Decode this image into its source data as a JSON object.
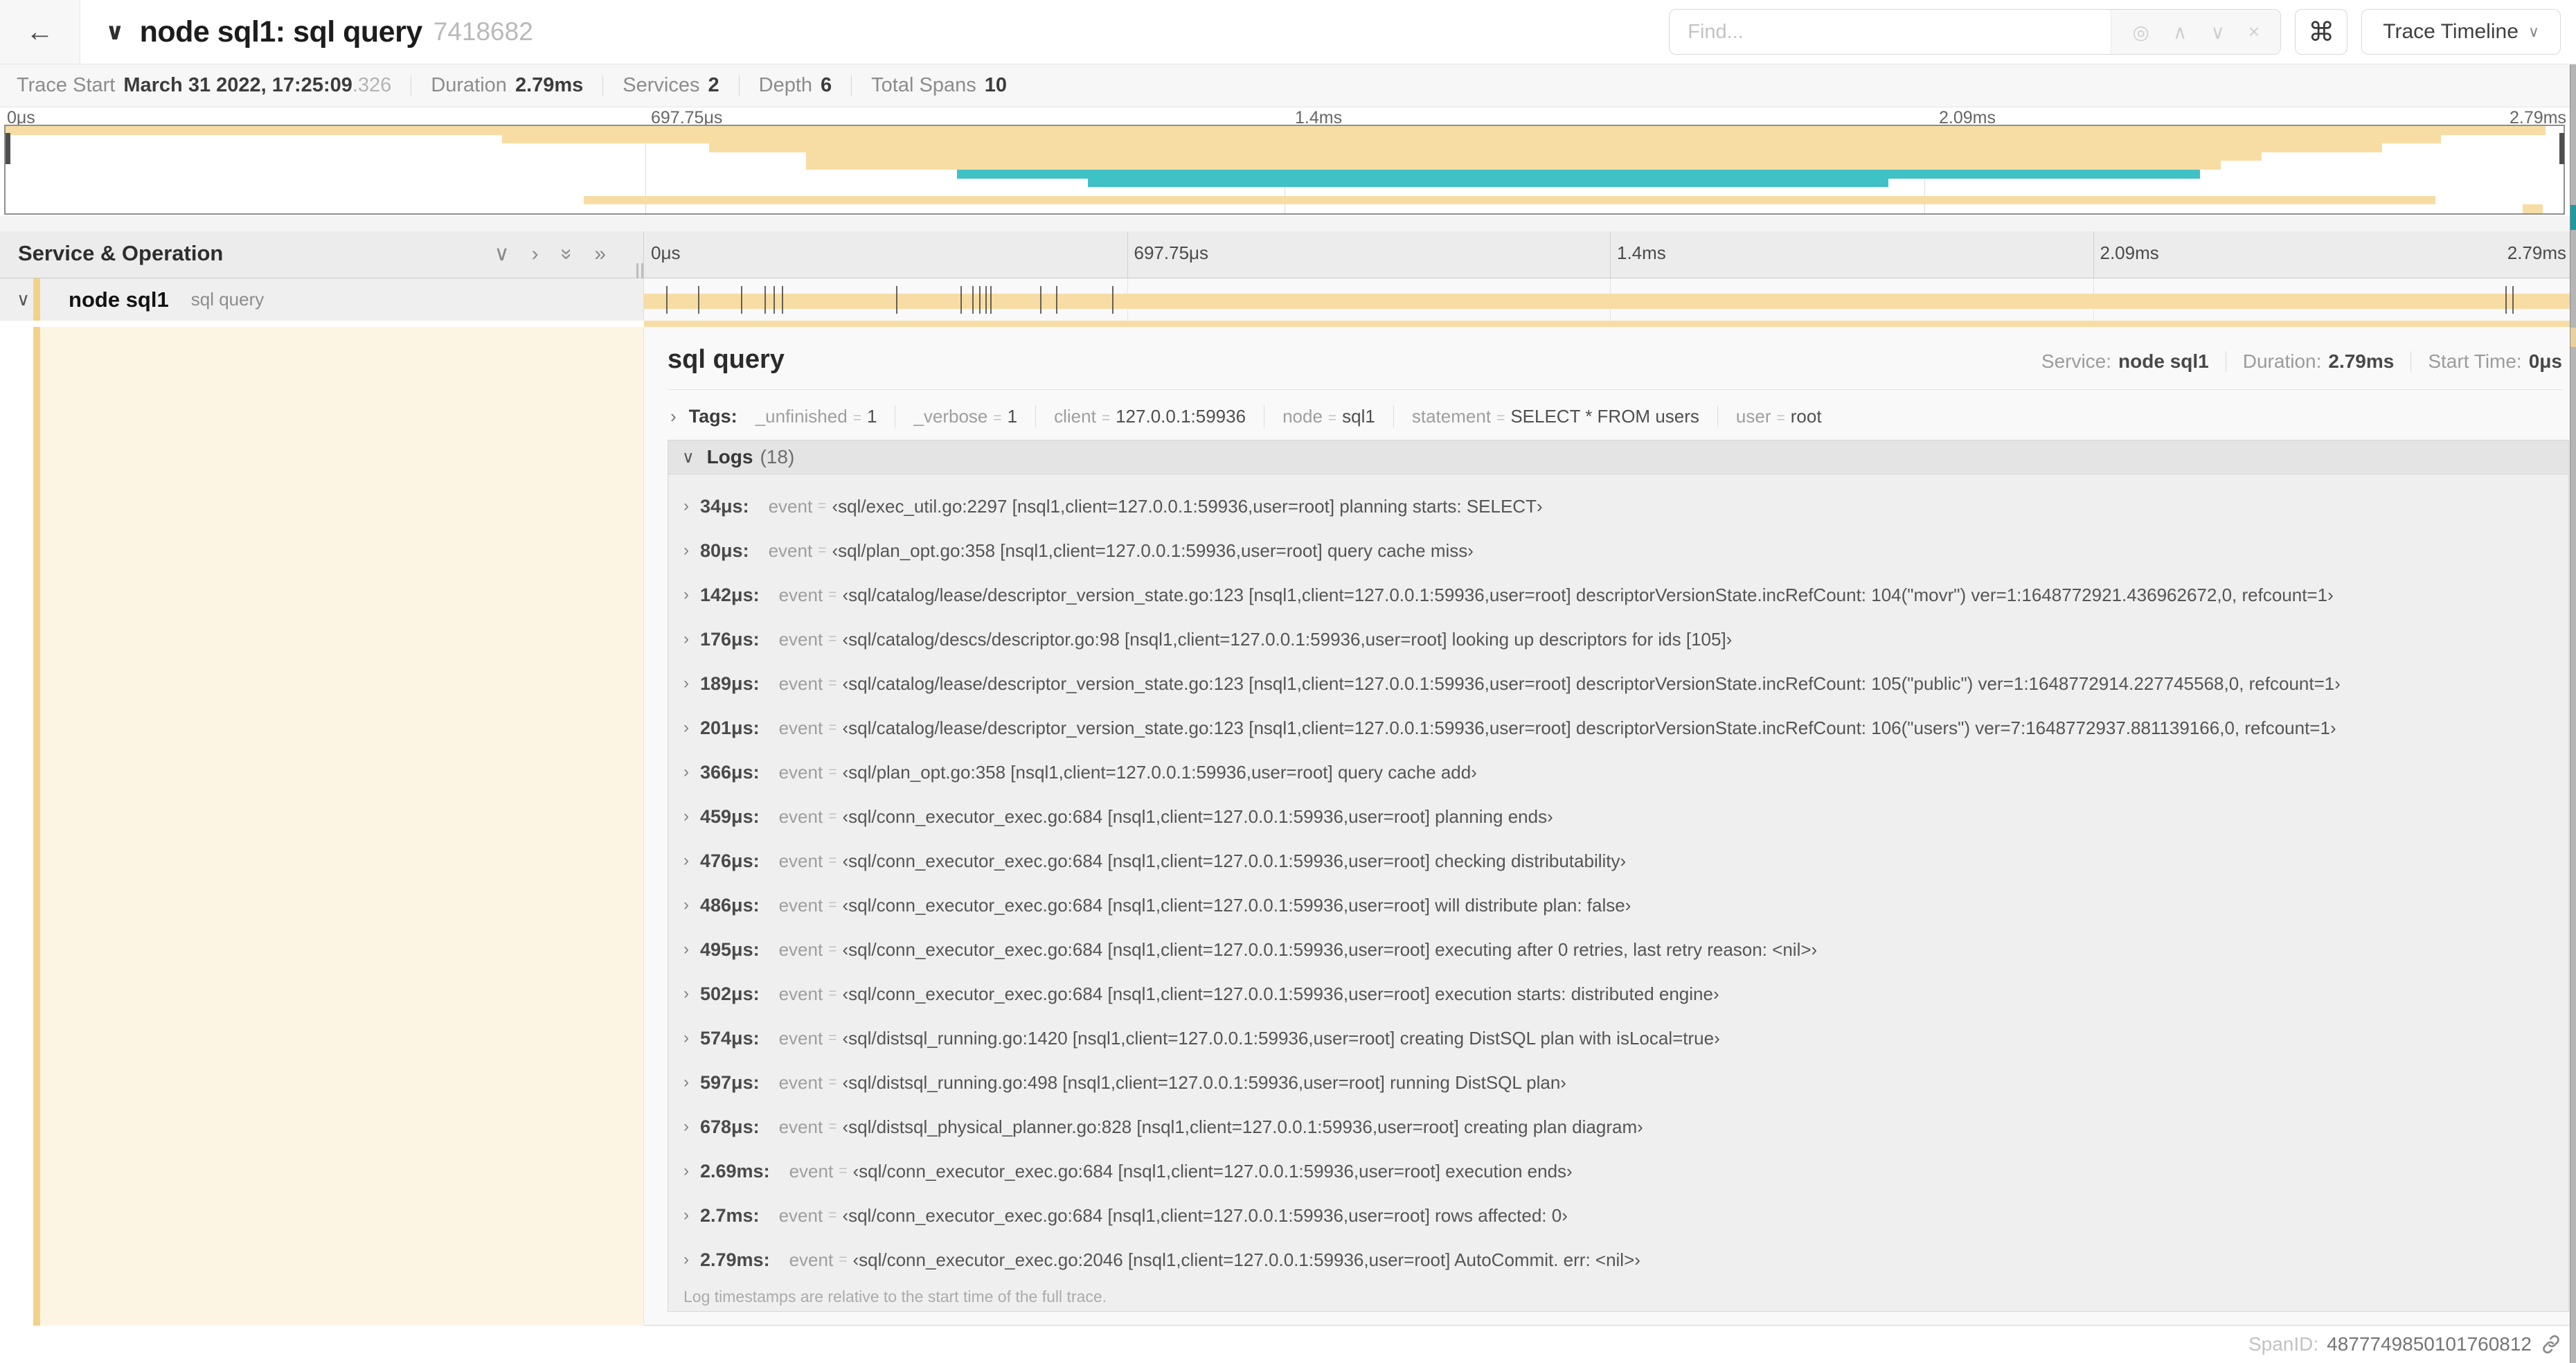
{
  "colors": {
    "span_cream": "#F7DDA4",
    "span_cream_strip": "#F2D28B",
    "span_cream_tint": "#FCF5E4",
    "span_teal": "#3FC1C6",
    "scrubber_gray": "#4E4E4E"
  },
  "topbar": {
    "back_icon": "←",
    "collapse_icon": "∨",
    "title": "node sql1: sql query",
    "trace_id": "7418682",
    "find_placeholder": "Find...",
    "find_icons": [
      "◎",
      "∧",
      "∨",
      "×"
    ],
    "shortcut_button": "⌘",
    "view_button": "Trace Timeline",
    "view_button_chevron": "∨"
  },
  "trace_info": {
    "items": [
      {
        "label": "Trace Start",
        "value": "March 31 2022, 17:25:09",
        "suffix": ".326"
      },
      {
        "label": "Duration",
        "value": "2.79ms",
        "suffix": ""
      },
      {
        "label": "Services",
        "value": "2",
        "suffix": ""
      },
      {
        "label": "Depth",
        "value": "6",
        "suffix": ""
      },
      {
        "label": "Total Spans",
        "value": "10",
        "suffix": ""
      }
    ]
  },
  "timeline": {
    "tick_labels": [
      "0μs",
      "697.75μs",
      "1.4ms",
      "2.09ms",
      "2.79ms"
    ],
    "duration_us": 2790
  },
  "minimap": {
    "spans": [
      {
        "row": 0,
        "start_pct": 0.0,
        "end_pct": 99.3,
        "color": "cream"
      },
      {
        "row": 1,
        "start_pct": 19.4,
        "end_pct": 95.2,
        "color": "cream"
      },
      {
        "row": 2,
        "start_pct": 27.5,
        "end_pct": 92.9,
        "color": "cream"
      },
      {
        "row": 3,
        "start_pct": 31.3,
        "end_pct": 88.2,
        "color": "cream"
      },
      {
        "row": 4,
        "start_pct": 31.3,
        "end_pct": 86.6,
        "color": "cream"
      },
      {
        "row": 5,
        "start_pct": 37.2,
        "end_pct": 85.8,
        "color": "teal"
      },
      {
        "row": 6,
        "start_pct": 42.3,
        "end_pct": 73.6,
        "color": "teal"
      },
      {
        "row": 8,
        "start_pct": 22.6,
        "end_pct": 95.0,
        "color": "cream"
      },
      {
        "row": 9,
        "start_pct": 98.4,
        "end_pct": 99.2,
        "color": "cream"
      }
    ]
  },
  "left_panel": {
    "title": "Service & Operation",
    "icons": [
      "∨",
      "›",
      "»",
      "»"
    ]
  },
  "span_row": {
    "chevron": "∨",
    "service": "node sql1",
    "operation": "sql query",
    "log_marks_us": [
      34,
      80,
      142,
      176,
      189,
      201,
      366,
      459,
      476,
      486,
      495,
      502,
      574,
      597,
      678,
      2690,
      2700,
      2790
    ]
  },
  "detail": {
    "operation": "sql query",
    "service_label": "Service:",
    "service": "node sql1",
    "duration_label": "Duration:",
    "duration": "2.79ms",
    "start_label": "Start Time:",
    "start": "0μs",
    "tags_chevron": "›",
    "tags_label": "Tags:",
    "tags": [
      {
        "key": "_unfinished",
        "value": "1"
      },
      {
        "key": "_verbose",
        "value": "1"
      },
      {
        "key": "client",
        "value": "127.0.0.1:59936"
      },
      {
        "key": "node",
        "value": "sql1"
      },
      {
        "key": "statement",
        "value": "SELECT * FROM users"
      },
      {
        "key": "user",
        "value": "root"
      }
    ],
    "logs_chevron": "∨",
    "logs_label": "Logs",
    "logs_count": "(18)",
    "logs": [
      {
        "time": "34μs:",
        "field": "event",
        "value": "‹sql/exec_util.go:2297 [nsql1,client=127.0.0.1:59936,user=root] planning starts: SELECT›"
      },
      {
        "time": "80μs:",
        "field": "event",
        "value": "‹sql/plan_opt.go:358 [nsql1,client=127.0.0.1:59936,user=root] query cache miss›"
      },
      {
        "time": "142μs:",
        "field": "event",
        "value": "‹sql/catalog/lease/descriptor_version_state.go:123 [nsql1,client=127.0.0.1:59936,user=root] descriptorVersionState.incRefCount: 104(\"movr\") ver=1:1648772921.436962672,0, refcount=1›"
      },
      {
        "time": "176μs:",
        "field": "event",
        "value": "‹sql/catalog/descs/descriptor.go:98 [nsql1,client=127.0.0.1:59936,user=root] looking up descriptors for ids [105]›"
      },
      {
        "time": "189μs:",
        "field": "event",
        "value": "‹sql/catalog/lease/descriptor_version_state.go:123 [nsql1,client=127.0.0.1:59936,user=root] descriptorVersionState.incRefCount: 105(\"public\") ver=1:1648772914.227745568,0, refcount=1›"
      },
      {
        "time": "201μs:",
        "field": "event",
        "value": "‹sql/catalog/lease/descriptor_version_state.go:123 [nsql1,client=127.0.0.1:59936,user=root] descriptorVersionState.incRefCount: 106(\"users\") ver=7:1648772937.881139166,0, refcount=1›"
      },
      {
        "time": "366μs:",
        "field": "event",
        "value": "‹sql/plan_opt.go:358 [nsql1,client=127.0.0.1:59936,user=root] query cache add›"
      },
      {
        "time": "459μs:",
        "field": "event",
        "value": "‹sql/conn_executor_exec.go:684 [nsql1,client=127.0.0.1:59936,user=root] planning ends›"
      },
      {
        "time": "476μs:",
        "field": "event",
        "value": "‹sql/conn_executor_exec.go:684 [nsql1,client=127.0.0.1:59936,user=root] checking distributability›"
      },
      {
        "time": "486μs:",
        "field": "event",
        "value": "‹sql/conn_executor_exec.go:684 [nsql1,client=127.0.0.1:59936,user=root] will distribute plan: false›"
      },
      {
        "time": "495μs:",
        "field": "event",
        "value": "‹sql/conn_executor_exec.go:684 [nsql1,client=127.0.0.1:59936,user=root] executing after 0 retries, last retry reason: <nil>›"
      },
      {
        "time": "502μs:",
        "field": "event",
        "value": "‹sql/conn_executor_exec.go:684 [nsql1,client=127.0.0.1:59936,user=root] execution starts: distributed engine›"
      },
      {
        "time": "574μs:",
        "field": "event",
        "value": "‹sql/distsql_running.go:1420 [nsql1,client=127.0.0.1:59936,user=root] creating DistSQL plan with isLocal=true›"
      },
      {
        "time": "597μs:",
        "field": "event",
        "value": "‹sql/distsql_running.go:498 [nsql1,client=127.0.0.1:59936,user=root] running DistSQL plan›"
      },
      {
        "time": "678μs:",
        "field": "event",
        "value": "‹sql/distsql_physical_planner.go:828 [nsql1,client=127.0.0.1:59936,user=root] creating plan diagram›"
      },
      {
        "time": "2.69ms:",
        "field": "event",
        "value": "‹sql/conn_executor_exec.go:684 [nsql1,client=127.0.0.1:59936,user=root] execution ends›"
      },
      {
        "time": "2.7ms:",
        "field": "event",
        "value": "‹sql/conn_executor_exec.go:684 [nsql1,client=127.0.0.1:59936,user=root] rows affected: 0›"
      },
      {
        "time": "2.79ms:",
        "field": "event",
        "value": "‹sql/conn_executor_exec.go:2046 [nsql1,client=127.0.0.1:59936,user=root] AutoCommit. err: <nil>›"
      }
    ],
    "note": "Log timestamps are relative to the start time of the full trace.",
    "span_id_label": "SpanID:",
    "span_id": "4877749850101760812"
  }
}
